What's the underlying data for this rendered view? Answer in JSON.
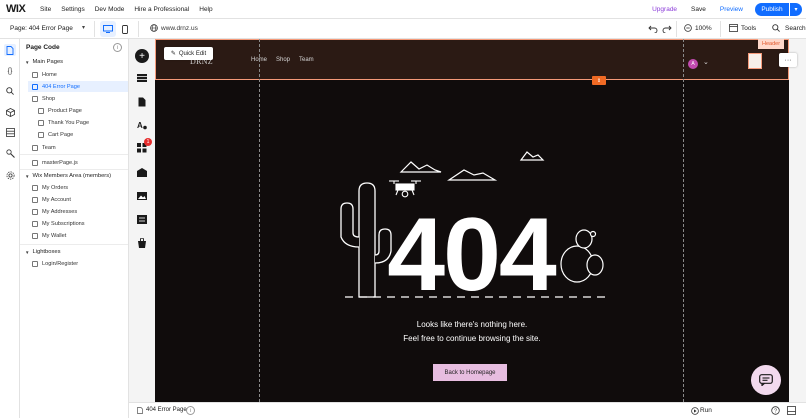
{
  "topbar": {
    "logo": "WIX",
    "menu": [
      "Site",
      "Settings",
      "Dev Mode",
      "Hire a Professional",
      "Help"
    ],
    "upgrade": "Upgrade",
    "save": "Save",
    "preview": "Preview",
    "publish": "Publish"
  },
  "secondbar": {
    "page_label": "Page: 404 Error Page",
    "url": "www.drnz.us",
    "zoom": "100%",
    "tools": "Tools",
    "search": "Search"
  },
  "panel": {
    "title": "Page Code",
    "sections": {
      "main_pages": "Main Pages",
      "members": "Wix Members Area (members)",
      "lightboxes": "Lightboxes"
    },
    "items": {
      "home": "Home",
      "error_page": "404 Error Page",
      "shop": "Shop",
      "product_page": "Product Page",
      "thank_you": "Thank You Page",
      "cart_page": "Cart Page",
      "team": "Team",
      "master_page": "masterPage.js",
      "my_orders": "My Orders",
      "my_account": "My Account",
      "my_addresses": "My Addresses",
      "my_subscriptions": "My Subscriptions",
      "my_wallet": "My Wallet",
      "login_register": "Login/Register"
    }
  },
  "rail": {
    "badge_count": "1"
  },
  "site": {
    "brand": "DRNZ",
    "nav": [
      "Home",
      "Shop",
      "Team"
    ],
    "avatar_letter": "A",
    "header_tag": "Header",
    "quick_edit": "Quick Edit",
    "error_code": "404",
    "message_line1": "Looks like there's nothing here.",
    "message_line2": "Feel free to continue browsing the site.",
    "back_button": "Back to Homepage",
    "colors": {
      "background": "#100c0c",
      "header_bg": "#2b1a14",
      "button_bg": "#e7bde0",
      "accent": "#f06a24"
    }
  },
  "bottombar": {
    "file_name": "404 Error Page",
    "run": "Run"
  },
  "colors": {
    "wix_blue": "#116dff",
    "upgrade_purple": "#8b3bd9"
  }
}
